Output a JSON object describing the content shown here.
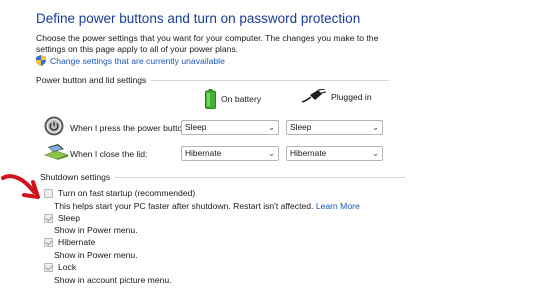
{
  "header": {
    "title": "Define power buttons and turn on password protection",
    "description": "Choose the power settings that you want for your computer. The changes you make to the settings on this page apply to all of your power plans.",
    "change_settings_link": "Change settings that are currently unavailable"
  },
  "power_lid": {
    "section_label": "Power button and lid settings",
    "col_battery": "On battery",
    "col_plugged": "Plugged in",
    "rows": [
      {
        "label": "When I press the power button:",
        "on_battery": "Sleep",
        "plugged_in": "Sleep"
      },
      {
        "label": "When I close the lid:",
        "on_battery": "Hibernate",
        "plugged_in": "Hibernate"
      }
    ]
  },
  "shutdown": {
    "section_label": "Shutdown settings",
    "fast_startup": {
      "label": "Turn on fast startup (recommended)",
      "desc": "This helps start your PC faster after shutdown. Restart isn't affected.",
      "learn_more": "Learn More",
      "checked": false
    },
    "sleep": {
      "label": "Sleep",
      "desc": "Show in Power menu.",
      "checked": true
    },
    "hibernate": {
      "label": "Hibernate",
      "desc": "Show in Power menu.",
      "checked": true
    },
    "lock": {
      "label": "Lock",
      "desc": "Show in account picture menu.",
      "checked": true
    }
  },
  "colors": {
    "title": "#1a3c94",
    "link": "#1a56b8",
    "annotation_arrow": "#d0121b"
  }
}
